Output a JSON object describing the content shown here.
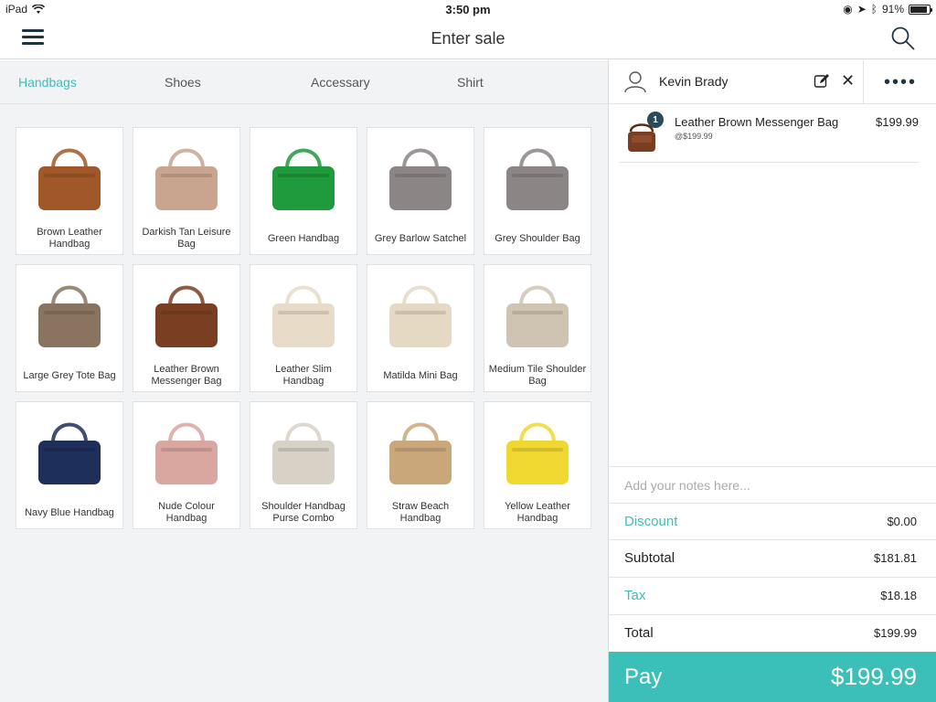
{
  "status_bar": {
    "device": "iPad",
    "time": "3:50 pm",
    "battery": "91%",
    "battery_level": 0.91
  },
  "navbar": {
    "title": "Enter sale",
    "menu_icon": "hamburger-menu-icon",
    "search_icon": "search-icon"
  },
  "tabs": [
    {
      "label": "Handbags",
      "active": true
    },
    {
      "label": "Shoes",
      "active": false
    },
    {
      "label": "Accessary",
      "active": false
    },
    {
      "label": "Shirt",
      "active": false
    }
  ],
  "products": [
    {
      "name": "Brown Leather Handbag",
      "color": "#a0582a"
    },
    {
      "name": "Darkish Tan Leisure Bag",
      "color": "#c9a590"
    },
    {
      "name": "Green Handbag",
      "color": "#1f9a3c"
    },
    {
      "name": "Grey Barlow Satchel",
      "color": "#8c8585"
    },
    {
      "name": "Grey Shoulder Bag",
      "color": "#8c8585"
    },
    {
      "name": "Large Grey Tote Bag",
      "color": "#8a7460"
    },
    {
      "name": "Leather Brown Messenger Bag",
      "color": "#7a3f22"
    },
    {
      "name": "Leather Slim Handbag",
      "color": "#e8dcc8"
    },
    {
      "name": "Matilda Mini Bag",
      "color": "#e6d9c4"
    },
    {
      "name": "Medium Tile Shoulder Bag",
      "color": "#cfc4b2"
    },
    {
      "name": "Navy Blue Handbag",
      "color": "#1e2f5c"
    },
    {
      "name": "Nude Colour Handbag",
      "color": "#d9a6a0"
    },
    {
      "name": "Shoulder Handbag Purse Combo",
      "color": "#d8d2c6"
    },
    {
      "name": "Straw Beach Handbag",
      "color": "#c9a77a"
    },
    {
      "name": "Yellow Leather Handbag",
      "color": "#f0d830"
    }
  ],
  "customer": {
    "name": "Kevin Brady"
  },
  "cart": {
    "items": [
      {
        "name": "Leather Brown Messenger Bag",
        "sub": "@$199.99",
        "price": "$199.99",
        "qty": "1"
      }
    ]
  },
  "notes_placeholder": "Add your notes here...",
  "summary": {
    "discount_label": "Discount",
    "discount": "$0.00",
    "subtotal_label": "Subtotal",
    "subtotal": "$181.81",
    "tax_label": "Tax",
    "tax": "$18.18",
    "total_label": "Total",
    "total": "$199.99"
  },
  "pay": {
    "label": "Pay",
    "amount": "$199.99"
  },
  "colors": {
    "accent": "#3cbfb8",
    "dark": "#1f3440"
  }
}
